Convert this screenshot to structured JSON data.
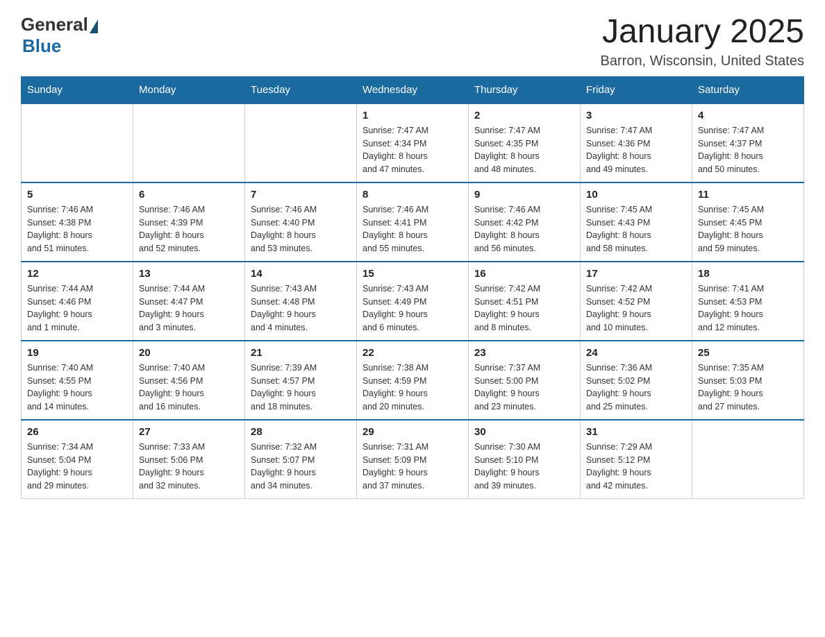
{
  "logo": {
    "general": "General",
    "blue": "Blue"
  },
  "header": {
    "title": "January 2025",
    "subtitle": "Barron, Wisconsin, United States"
  },
  "weekdays": [
    "Sunday",
    "Monday",
    "Tuesday",
    "Wednesday",
    "Thursday",
    "Friday",
    "Saturday"
  ],
  "weeks": [
    [
      {
        "day": "",
        "info": ""
      },
      {
        "day": "",
        "info": ""
      },
      {
        "day": "",
        "info": ""
      },
      {
        "day": "1",
        "info": "Sunrise: 7:47 AM\nSunset: 4:34 PM\nDaylight: 8 hours\nand 47 minutes."
      },
      {
        "day": "2",
        "info": "Sunrise: 7:47 AM\nSunset: 4:35 PM\nDaylight: 8 hours\nand 48 minutes."
      },
      {
        "day": "3",
        "info": "Sunrise: 7:47 AM\nSunset: 4:36 PM\nDaylight: 8 hours\nand 49 minutes."
      },
      {
        "day": "4",
        "info": "Sunrise: 7:47 AM\nSunset: 4:37 PM\nDaylight: 8 hours\nand 50 minutes."
      }
    ],
    [
      {
        "day": "5",
        "info": "Sunrise: 7:46 AM\nSunset: 4:38 PM\nDaylight: 8 hours\nand 51 minutes."
      },
      {
        "day": "6",
        "info": "Sunrise: 7:46 AM\nSunset: 4:39 PM\nDaylight: 8 hours\nand 52 minutes."
      },
      {
        "day": "7",
        "info": "Sunrise: 7:46 AM\nSunset: 4:40 PM\nDaylight: 8 hours\nand 53 minutes."
      },
      {
        "day": "8",
        "info": "Sunrise: 7:46 AM\nSunset: 4:41 PM\nDaylight: 8 hours\nand 55 minutes."
      },
      {
        "day": "9",
        "info": "Sunrise: 7:46 AM\nSunset: 4:42 PM\nDaylight: 8 hours\nand 56 minutes."
      },
      {
        "day": "10",
        "info": "Sunrise: 7:45 AM\nSunset: 4:43 PM\nDaylight: 8 hours\nand 58 minutes."
      },
      {
        "day": "11",
        "info": "Sunrise: 7:45 AM\nSunset: 4:45 PM\nDaylight: 8 hours\nand 59 minutes."
      }
    ],
    [
      {
        "day": "12",
        "info": "Sunrise: 7:44 AM\nSunset: 4:46 PM\nDaylight: 9 hours\nand 1 minute."
      },
      {
        "day": "13",
        "info": "Sunrise: 7:44 AM\nSunset: 4:47 PM\nDaylight: 9 hours\nand 3 minutes."
      },
      {
        "day": "14",
        "info": "Sunrise: 7:43 AM\nSunset: 4:48 PM\nDaylight: 9 hours\nand 4 minutes."
      },
      {
        "day": "15",
        "info": "Sunrise: 7:43 AM\nSunset: 4:49 PM\nDaylight: 9 hours\nand 6 minutes."
      },
      {
        "day": "16",
        "info": "Sunrise: 7:42 AM\nSunset: 4:51 PM\nDaylight: 9 hours\nand 8 minutes."
      },
      {
        "day": "17",
        "info": "Sunrise: 7:42 AM\nSunset: 4:52 PM\nDaylight: 9 hours\nand 10 minutes."
      },
      {
        "day": "18",
        "info": "Sunrise: 7:41 AM\nSunset: 4:53 PM\nDaylight: 9 hours\nand 12 minutes."
      }
    ],
    [
      {
        "day": "19",
        "info": "Sunrise: 7:40 AM\nSunset: 4:55 PM\nDaylight: 9 hours\nand 14 minutes."
      },
      {
        "day": "20",
        "info": "Sunrise: 7:40 AM\nSunset: 4:56 PM\nDaylight: 9 hours\nand 16 minutes."
      },
      {
        "day": "21",
        "info": "Sunrise: 7:39 AM\nSunset: 4:57 PM\nDaylight: 9 hours\nand 18 minutes."
      },
      {
        "day": "22",
        "info": "Sunrise: 7:38 AM\nSunset: 4:59 PM\nDaylight: 9 hours\nand 20 minutes."
      },
      {
        "day": "23",
        "info": "Sunrise: 7:37 AM\nSunset: 5:00 PM\nDaylight: 9 hours\nand 23 minutes."
      },
      {
        "day": "24",
        "info": "Sunrise: 7:36 AM\nSunset: 5:02 PM\nDaylight: 9 hours\nand 25 minutes."
      },
      {
        "day": "25",
        "info": "Sunrise: 7:35 AM\nSunset: 5:03 PM\nDaylight: 9 hours\nand 27 minutes."
      }
    ],
    [
      {
        "day": "26",
        "info": "Sunrise: 7:34 AM\nSunset: 5:04 PM\nDaylight: 9 hours\nand 29 minutes."
      },
      {
        "day": "27",
        "info": "Sunrise: 7:33 AM\nSunset: 5:06 PM\nDaylight: 9 hours\nand 32 minutes."
      },
      {
        "day": "28",
        "info": "Sunrise: 7:32 AM\nSunset: 5:07 PM\nDaylight: 9 hours\nand 34 minutes."
      },
      {
        "day": "29",
        "info": "Sunrise: 7:31 AM\nSunset: 5:09 PM\nDaylight: 9 hours\nand 37 minutes."
      },
      {
        "day": "30",
        "info": "Sunrise: 7:30 AM\nSunset: 5:10 PM\nDaylight: 9 hours\nand 39 minutes."
      },
      {
        "day": "31",
        "info": "Sunrise: 7:29 AM\nSunset: 5:12 PM\nDaylight: 9 hours\nand 42 minutes."
      },
      {
        "day": "",
        "info": ""
      }
    ]
  ]
}
